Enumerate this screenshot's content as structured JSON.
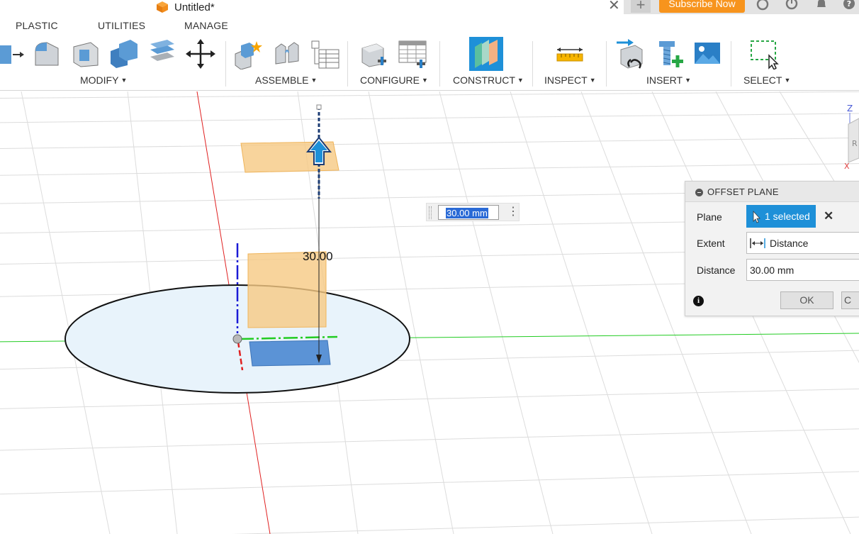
{
  "titlebar": {
    "document_title": "Untitled*",
    "subscribe_label": "Subscribe Now",
    "new_tab_symbol": "+",
    "close_symbol": "✕"
  },
  "tabs": [
    {
      "label": "PLASTIC"
    },
    {
      "label": "UTILITIES"
    },
    {
      "label": "MANAGE"
    }
  ],
  "toolbar": {
    "groups": {
      "modify": "MODIFY",
      "assemble": "ASSEMBLE",
      "configure": "CONFIGURE",
      "construct": "CONSTRUCT",
      "inspect": "INSPECT",
      "insert": "INSERT",
      "select": "SELECT"
    },
    "dropdown_symbol": "▼"
  },
  "viewport": {
    "dimension_label": "30.00",
    "float_input": {
      "value": "30.00 mm",
      "menu_symbol": "⋮"
    },
    "viewcube_labels": {
      "z": "Z",
      "x": "X",
      "face": "R"
    }
  },
  "dialog": {
    "title": "OFFSET PLANE",
    "plane": {
      "label": "Plane",
      "selection": "1 selected",
      "clear_symbol": "✕"
    },
    "extent": {
      "label": "Extent",
      "value": "Distance"
    },
    "distance": {
      "label": "Distance",
      "value": "30.00 mm"
    },
    "info_symbol": "i",
    "ok_label": "OK",
    "cancel_label": "C"
  },
  "colors": {
    "accent_blue": "#1e90d8",
    "subscribe_orange": "#f7941d",
    "plane_orange": "#f6c983",
    "x_axis_red": "#e02020",
    "y_axis_green": "#22cc22",
    "z_axis_blue": "#1a1ad6"
  },
  "icons": [
    "document-cube-icon",
    "new-tab-icon",
    "help-icon",
    "notification-icon",
    "history-icon",
    "offline-icon",
    "cursor-icon",
    "distance-icon",
    "info-icon",
    "manipulator-arrow-icon"
  ]
}
